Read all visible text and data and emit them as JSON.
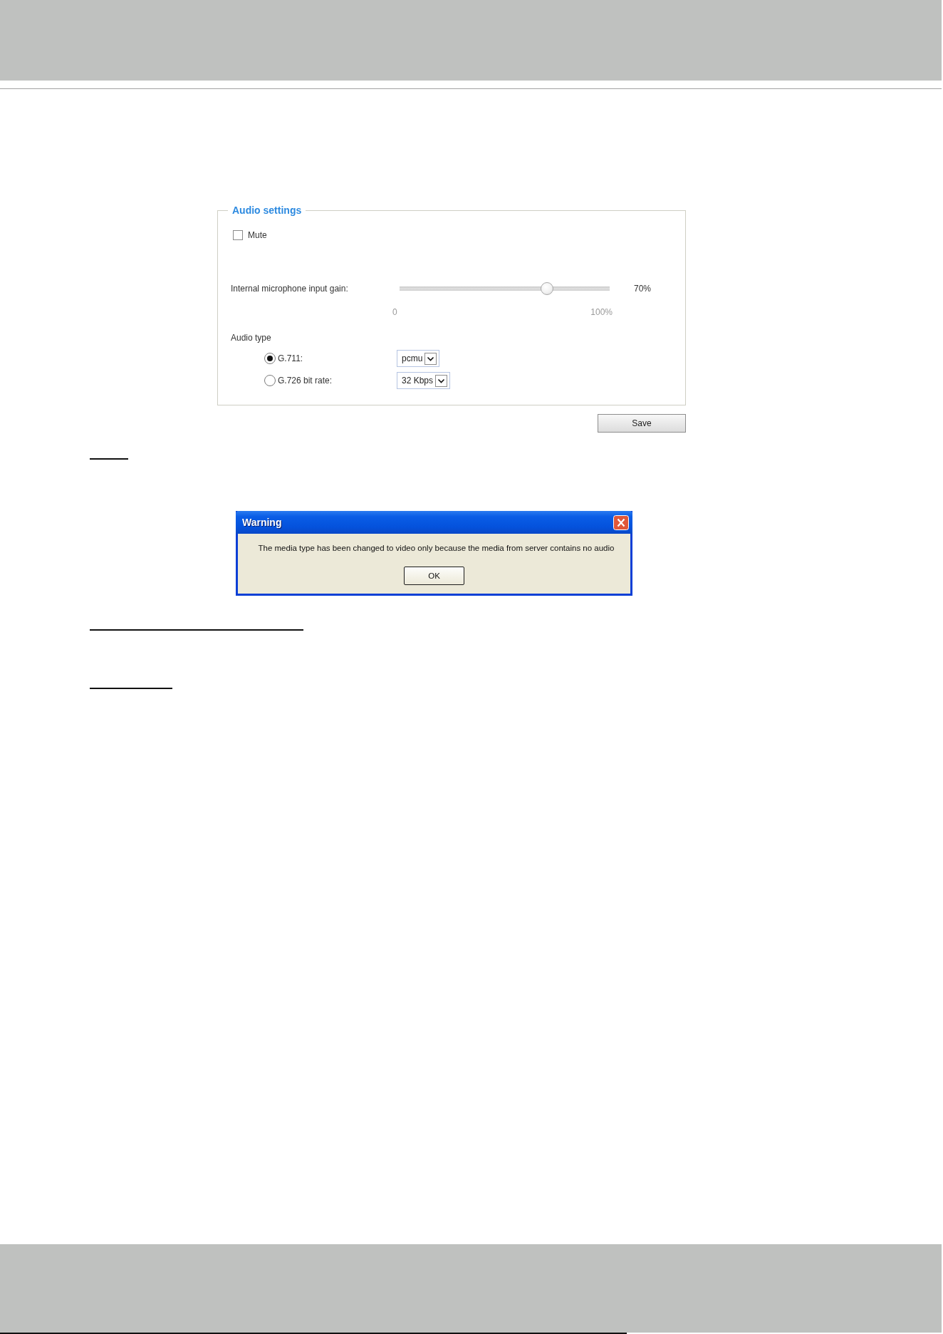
{
  "panel": {
    "title": "Audio settings",
    "mute": {
      "label": "Mute",
      "checked": false
    },
    "gain": {
      "label": "Internal microphone input gain:",
      "level": 0.7,
      "reading": "70%",
      "min_label": "0",
      "max_label": "100%"
    },
    "audio_type": {
      "label": "Audio type",
      "options": [
        {
          "label": "G.711:",
          "selected": true,
          "value": "pcmu"
        },
        {
          "label": "G.726 bit rate:",
          "selected": false,
          "value": "32 Kbps"
        }
      ]
    }
  },
  "save_button": "Save",
  "dialog": {
    "title": "Warning",
    "message": "The media type has been changed to video only because the media from server contains no audio",
    "ok_button": "OK"
  }
}
